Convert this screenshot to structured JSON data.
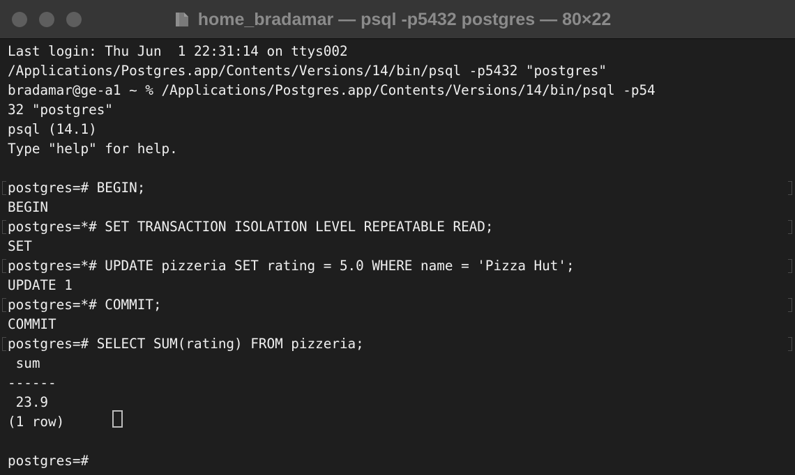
{
  "window": {
    "title": "home_bradamar — psql -p5432 postgres — 80×22",
    "title_icon": "folder-icon",
    "traffic_lights": [
      "close",
      "minimize",
      "zoom"
    ],
    "traffic_light_color": "#5e5e5e"
  },
  "terminal": {
    "background": "#1e1e1e",
    "text_color": "#f0f0f0",
    "lines": [
      "Last login: Thu Jun  1 22:31:14 on ttys002",
      "/Applications/Postgres.app/Contents/Versions/14/bin/psql -p5432 \"postgres\"",
      "bradamar@ge-a1 ~ % /Applications/Postgres.app/Contents/Versions/14/bin/psql -p54",
      "32 \"postgres\"",
      "psql (14.1)",
      "Type \"help\" for help.",
      "",
      "postgres=# BEGIN;",
      "BEGIN",
      "postgres=*# SET TRANSACTION ISOLATION LEVEL REPEATABLE READ;",
      "SET",
      "postgres=*# UPDATE pizzeria SET rating = 5.0 WHERE name = 'Pizza Hut';",
      "UPDATE 1",
      "postgres=*# COMMIT;",
      "COMMIT",
      "postgres=# SELECT SUM(rating) FROM pizzeria;",
      " sum",
      "------",
      " 23.9",
      "(1 row)",
      "",
      "postgres=# "
    ],
    "marked_line_indices": [
      7,
      9,
      11,
      13,
      15
    ],
    "prompt": "postgres=#"
  }
}
